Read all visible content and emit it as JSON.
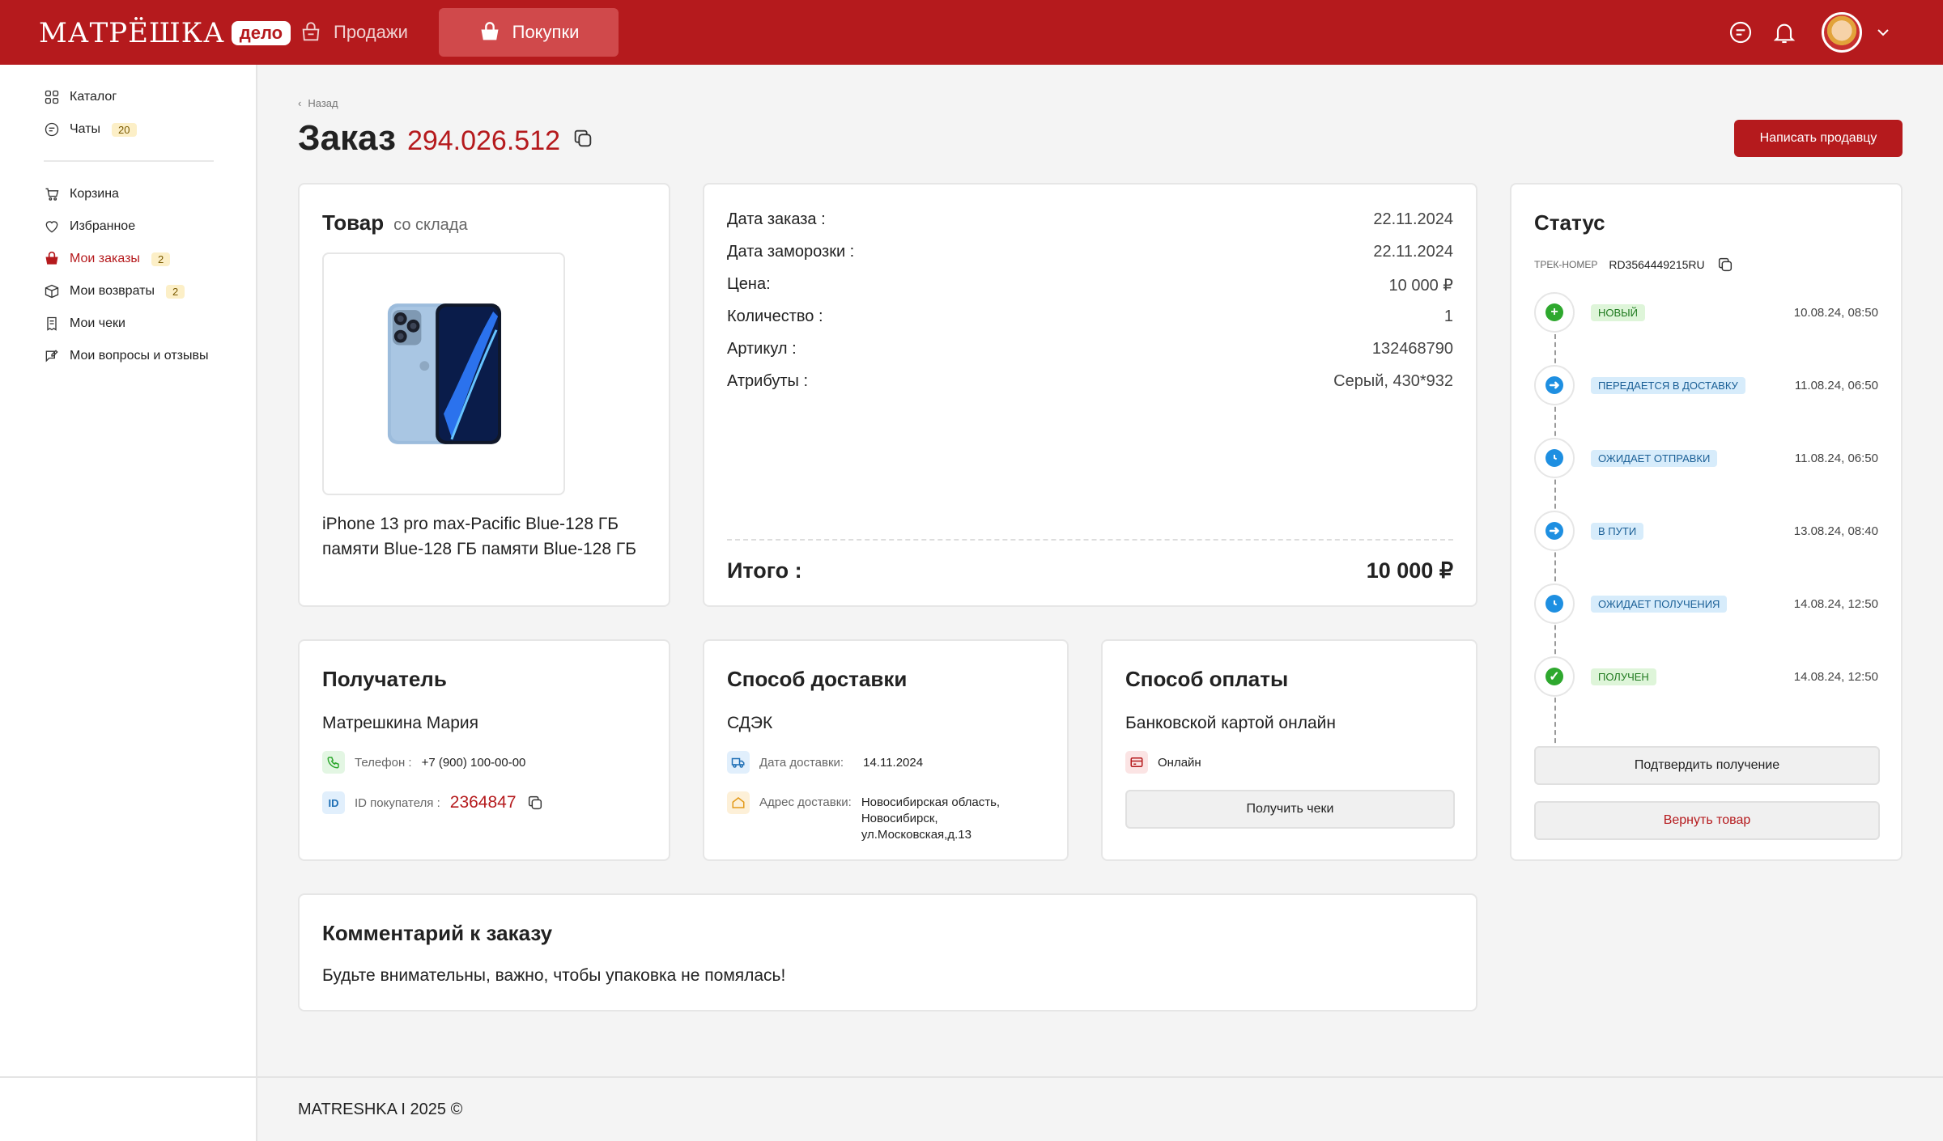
{
  "header": {
    "logo_text": "МАТРЁШКА",
    "logo_badge": "дело",
    "tabs": [
      {
        "label": "Продажи"
      },
      {
        "label": "Покупки"
      }
    ]
  },
  "sidebar": {
    "items": [
      {
        "label": "Каталог"
      },
      {
        "label": "Чаты",
        "badge": "20"
      },
      {
        "label": "Корзина"
      },
      {
        "label": "Избранное"
      },
      {
        "label": "Мои заказы",
        "badge": "2"
      },
      {
        "label": "Мои возвраты",
        "badge": "2"
      },
      {
        "label": "Мои чеки"
      },
      {
        "label": "Мои вопросы и отзывы"
      }
    ]
  },
  "page": {
    "back": "Назад",
    "title": "Заказ",
    "order_number": "294.026.512",
    "write_seller": "Написать продавцу"
  },
  "product": {
    "title": "Товар",
    "subtitle": "со склада",
    "name": "iPhone 13 pro max-Pacific Blue-128 ГБ памяти Blue-128 ГБ памяти Blue-128 ГБ"
  },
  "details": {
    "rows": [
      {
        "label": "Дата заказа :",
        "value": "22.11.2024"
      },
      {
        "label": "Дата заморозки :",
        "value": "22.11.2024"
      },
      {
        "label": "Цена:",
        "value": "10 000 ₽"
      },
      {
        "label": "Количество :",
        "value": "1"
      },
      {
        "label": "Артикул :",
        "value": "132468790"
      },
      {
        "label": "Атрибуты :",
        "value": "Серый,  430*932"
      }
    ],
    "total_label": "Итого :",
    "total_value": "10 000 ₽"
  },
  "recipient": {
    "title": "Получатель",
    "name": "Матрешкина Мария",
    "phone_label": "Телефон :",
    "phone": "+7 (900) 100-00-00",
    "id_icon": "ID",
    "id_label": "ID покупателя :",
    "id_value": "2364847"
  },
  "delivery": {
    "title": "Способ доставки",
    "service": "СДЭК",
    "date_label": "Дата доставки:",
    "date": "14.11.2024",
    "address_label": "Адрес доставки:",
    "address": "Новосибирская область, Новосибирск, ул.Московская,д.13"
  },
  "payment": {
    "title": "Способ оплаты",
    "method": "Банковской картой онлайн",
    "type": "Онлайн",
    "receipts_button": "Получить чеки"
  },
  "status": {
    "title": "Статус",
    "track_label": "ТРЕК-НОМЕР",
    "track_number": "RD3564449215RU",
    "items": [
      {
        "label": "НОВЫЙ",
        "time": "10.08.24, 08:50",
        "icon": "plus-icon",
        "color": "#2ea82e"
      },
      {
        "label": "ПЕРЕДАЕТСЯ В ДОСТАВКУ",
        "time": "11.08.24, 06:50",
        "icon": "arrow-icon",
        "color": "#1e8fe1"
      },
      {
        "label": "ОЖИДАЕТ ОТПРАВКИ",
        "time": "11.08.24, 06:50",
        "icon": "clock-icon",
        "color": "#1e8fe1"
      },
      {
        "label": "В ПУТИ",
        "time": "13.08.24, 08:40",
        "icon": "arrow-icon",
        "color": "#1e8fe1"
      },
      {
        "label": "ОЖИДАЕТ ПОЛУЧЕНИЯ",
        "time": "14.08.24, 12:50",
        "icon": "clock-icon",
        "color": "#1e8fe1"
      },
      {
        "label": "ПОЛУЧЕН",
        "time": "14.08.24, 12:50",
        "icon": "check-icon",
        "color": "#2ea82e"
      }
    ],
    "confirm_button": "Подтвердить получение",
    "return_button": "Вернуть товар"
  },
  "comment": {
    "title": "Комментарий к заказу",
    "text": "Будьте внимательны, важно, чтобы упаковка не помялась!"
  },
  "footer": {
    "text": "MATRESHKA I 2025 ©"
  },
  "colors": {
    "brand": "#b51a1d",
    "green": "#2ea82e",
    "blue": "#1e8fe1"
  }
}
